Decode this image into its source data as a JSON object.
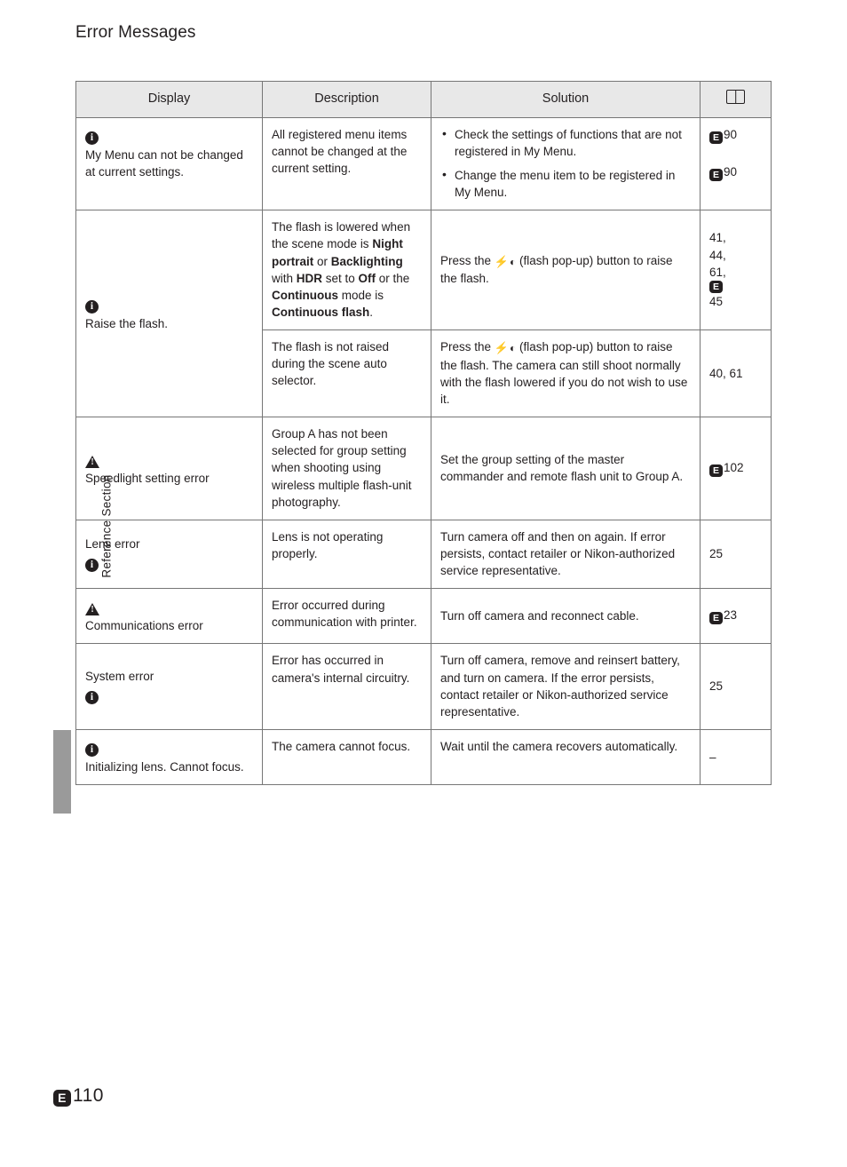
{
  "page": {
    "title": "Error Messages",
    "side_label": "Reference Section",
    "footer_prefix": "E",
    "footer_number": "110"
  },
  "table": {
    "headers": {
      "display": "Display",
      "description": "Description",
      "solution": "Solution",
      "reference": "book-icon"
    },
    "rows": [
      {
        "display_icon": "info-circle-icon",
        "display": "My Menu can not be changed at current settings.",
        "description": "All registered menu items cannot be changed at the current setting.",
        "solution_bullets": [
          "Check the settings of functions that are not registered in My Menu.",
          "Change the menu item to be registered in My Menu."
        ],
        "refs": [
          "E90",
          "E90"
        ]
      },
      {
        "display_icon": "info-circle-icon",
        "display": "Raise the flash.",
        "description_parts": [
          {
            "text": "The flash is lowered when the scene mode is ",
            "bold": false
          },
          {
            "text": "Night portrait",
            "bold": true
          },
          {
            "text": " or ",
            "bold": false
          },
          {
            "text": "Backlighting",
            "bold": true
          },
          {
            "text": " with ",
            "bold": false
          },
          {
            "text": "HDR",
            "bold": true
          },
          {
            "text": " set to ",
            "bold": false
          },
          {
            "text": "Off",
            "bold": true
          },
          {
            "text": " or the ",
            "bold": false
          },
          {
            "text": "Continuous",
            "bold": true
          },
          {
            "text": " mode is ",
            "bold": false
          },
          {
            "text": "Continuous flash",
            "bold": true
          },
          {
            "text": ".",
            "bold": false
          }
        ],
        "solution_pre": "Press the ",
        "solution_post": " (flash pop-up) button to raise the flash.",
        "refs_plain": [
          "41,",
          "44,",
          "61,"
        ],
        "ref_e": "E45"
      },
      {
        "description": "The flash is not raised during the scene auto selector.",
        "solution_pre": "Press the ",
        "solution_post": " (flash pop-up) button to raise the flash. The camera can still shoot normally with the flash lowered if you do not wish to use it.",
        "ref_plain": "40, 61"
      },
      {
        "display_icon": "warning-triangle-icon",
        "display": "Speedlight setting error",
        "description": "Group A has not been selected for group setting when shooting using wireless multiple flash-unit photography.",
        "solution": "Set the group setting of the master commander and remote flash unit to Group A.",
        "ref_e": "E102"
      },
      {
        "display": "Lens error",
        "display_icon_after": "info-circle-icon",
        "description": "Lens is not operating properly.",
        "solution": "Turn camera off and then on again. If error persists, contact retailer or Nikon-authorized service representative.",
        "ref_plain": "25"
      },
      {
        "display_icon": "warning-triangle-icon",
        "display": "Communications error",
        "description": "Error occurred during communication with printer.",
        "solution": "Turn off camera and reconnect cable.",
        "ref_e": "E23"
      },
      {
        "display": "System error",
        "display_icon_after": "info-circle-icon",
        "description": "Error has occurred in camera's internal circuitry.",
        "solution": "Turn off camera, remove and reinsert battery, and turn on camera. If the error persists, contact retailer or Nikon-authorized service representative.",
        "ref_plain": "25"
      },
      {
        "display_icon": "info-circle-icon",
        "display": "Initializing lens. Cannot focus.",
        "description": "The camera cannot focus.",
        "solution": "Wait until the camera recovers automatically.",
        "ref_plain": "–"
      }
    ]
  }
}
